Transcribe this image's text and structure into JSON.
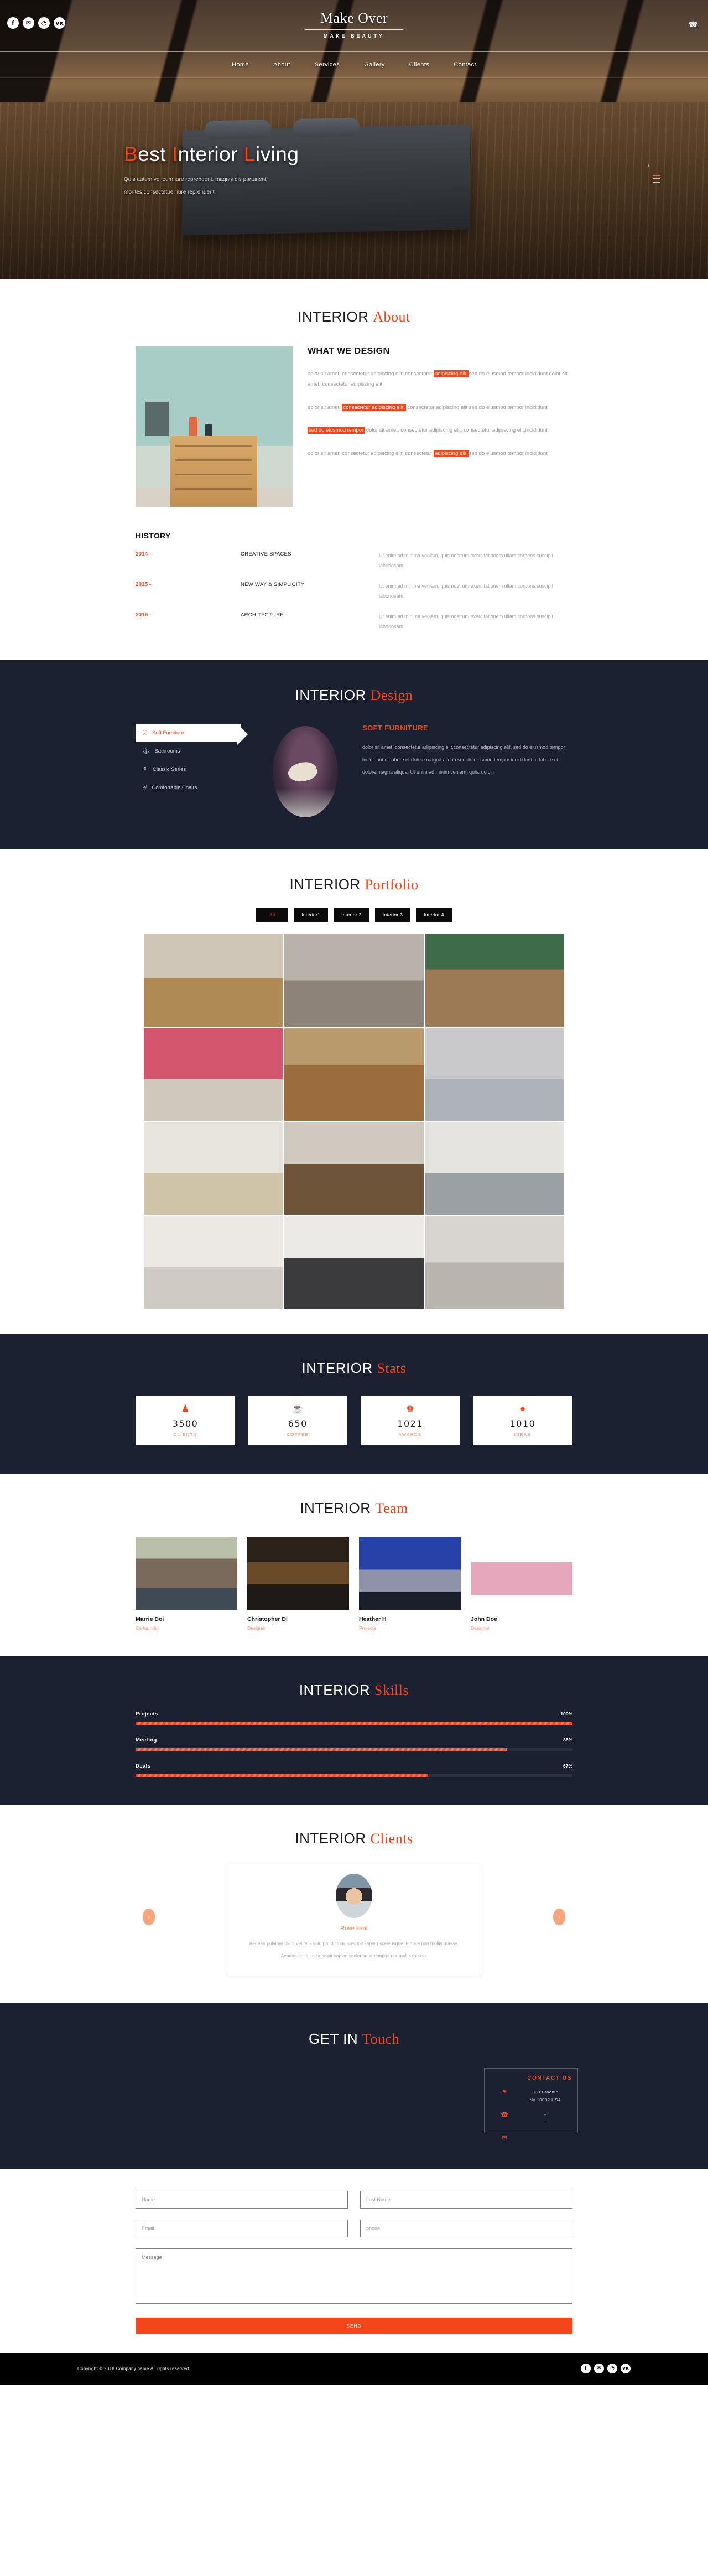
{
  "colors": {
    "accent": "#f4461a",
    "dark": "#1b2130",
    "black": "#000000",
    "muted": "#9a9a9a"
  },
  "header": {
    "brand_name": "Make Over",
    "brand_sub": "MAKE BEAUTY",
    "social": [
      {
        "name": "facebook-icon",
        "glyph": "f"
      },
      {
        "name": "twitter-icon",
        "glyph": "✉"
      },
      {
        "name": "rss-icon",
        "glyph": "◔"
      },
      {
        "name": "vk-icon",
        "glyph": "ᴠᴋ"
      }
    ],
    "phone_icon": "☎",
    "nav": [
      {
        "label": "Home"
      },
      {
        "label": "About"
      },
      {
        "label": "Services"
      },
      {
        "label": "Gallery"
      },
      {
        "label": "Clients"
      },
      {
        "label": "Contact"
      }
    ]
  },
  "hero": {
    "title_parts": [
      {
        "text": "B",
        "hl": true
      },
      {
        "text": "est ",
        "hl": false
      },
      {
        "text": "I",
        "hl": true
      },
      {
        "text": "nterior ",
        "hl": false
      },
      {
        "text": "L",
        "hl": true
      },
      {
        "text": "iving",
        "hl": false
      }
    ],
    "subtitle": "Quis autem vel eum iure reprehderit. magnis dis parturient montes,consectetuer iure reprehderit."
  },
  "about": {
    "title_main": "INTERIOR",
    "title_accent": "About",
    "heading": "WHAT WE DESIGN",
    "paragraphs": [
      [
        {
          "t": "dolor sit amet, consectetur adipiscing elit, consectetur ",
          "m": false
        },
        {
          "t": "adipiscing elit,",
          "m": true
        },
        {
          "t": "sed do eiusmod tempor incididunt dolor sit amet, consectetur adipiscing elit,",
          "m": false
        }
      ],
      [
        {
          "t": "dolor sit amet, ",
          "m": false
        },
        {
          "t": "consectetur adipiscing elit,",
          "m": true
        },
        {
          "t": " consectetur adipiscing elit,sed do eiusmod tempor incididunt",
          "m": false
        }
      ],
      [
        {
          "t": "sed do eiusmod tempor",
          "m": true
        },
        {
          "t": " dolor sit amet, consectetur adipiscing elit, consectetur adipiscing elit,incididunt",
          "m": false
        }
      ],
      [
        {
          "t": "dolor sit amet, consectetur adipiscing elit, consectetur ",
          "m": false
        },
        {
          "t": "adipiscing elit,",
          "m": true
        },
        {
          "t": "sed do eiusmod tempor incididunt",
          "m": false
        }
      ]
    ]
  },
  "history": {
    "heading": "HISTORY",
    "rows": [
      {
        "year": "2014 -",
        "title": "CREATIVE SPACES",
        "desc": "Ut enim ad minima veniam, quis nostrum exercitationem ullam corporis suscipit laboriosam."
      },
      {
        "year": "2015 -",
        "title": "NEW WAY & SIMPLICITY",
        "desc": "Ut enim ad minima veniam, quis nostrum exercitationem ullam corporis suscipit laboriosam."
      },
      {
        "year": "2016 -",
        "title": "ARCHITECTURE",
        "desc": "Ut enim ad minima veniam, quis nostrum exercitationem ullam corporis suscipit laboriosam."
      }
    ]
  },
  "design": {
    "title_main": "INTERIOR",
    "title_accent": "Design",
    "menu": [
      {
        "label": "Soft Furniture",
        "icon": "shuffle-icon",
        "glyph": "⤨",
        "active": true
      },
      {
        "label": "Bathrooms",
        "icon": "anchor-icon",
        "glyph": "⚓",
        "active": false
      },
      {
        "label": "Classic Series",
        "icon": "lamp-icon",
        "glyph": "⚘",
        "active": false
      },
      {
        "label": "Comfortable Chairs",
        "icon": "shield-icon",
        "glyph": "⛨",
        "active": false
      }
    ],
    "panel_heading": "SOFT FURNITURE",
    "panel_text": "dolor sit amet, consectetur adipiscing elit,consectetur adipiscing elit, sed do eiusmod tempor incididunt ut labore et dolore magna aliqua sed do eiusmod tempor incididunt ut labore et dolore magna aliqua. Ut enim ad minim veniam, quis. dolor ."
  },
  "portfolio": {
    "title_main": "INTERIOR",
    "title_accent": "Portfolio",
    "filters": [
      {
        "label": "All",
        "active": true
      },
      {
        "label": "Interior1",
        "active": false
      },
      {
        "label": "Interior 2",
        "active": false
      },
      {
        "label": "Interior 3",
        "active": false
      },
      {
        "label": "Interior 4",
        "active": false
      }
    ],
    "items": [
      {
        "name": "yellow-chairs-window"
      },
      {
        "name": "white-sofa-living"
      },
      {
        "name": "tropical-wall-lounge"
      },
      {
        "name": "pink-banquette-dining"
      },
      {
        "name": "twin-beds-bedroom"
      },
      {
        "name": "grey-attic-bedroom"
      },
      {
        "name": "olive-curtain-dining"
      },
      {
        "name": "chandelier-master-bedroom"
      },
      {
        "name": "open-plan-kitchen"
      },
      {
        "name": "white-pendant-kitchen"
      },
      {
        "name": "black-pendant-kitchen"
      },
      {
        "name": "modern-grey-kitchen"
      }
    ]
  },
  "stats": {
    "title_main": "INTERIOR",
    "title_accent": "Stats",
    "cards": [
      {
        "icon": "users-icon",
        "glyph": "♟",
        "value": "3500",
        "label": "CLIENTS"
      },
      {
        "icon": "coffee-icon",
        "glyph": "☕",
        "value": "650",
        "label": "COFFEE"
      },
      {
        "icon": "trophy-icon",
        "glyph": "♚",
        "value": "1021",
        "label": "AWARDS"
      },
      {
        "icon": "lightbulb-icon",
        "glyph": "●",
        "value": "1010",
        "label": "IDEAS"
      }
    ]
  },
  "team": {
    "title_main": "INTERIOR",
    "title_accent": "Team",
    "members": [
      {
        "name": "Marrie Doi",
        "role": "Co-founder"
      },
      {
        "name": "Christopher Di",
        "role": "Designer"
      },
      {
        "name": "Heather H",
        "role": "Projects"
      },
      {
        "name": "John Doe",
        "role": "Designer"
      }
    ]
  },
  "skills": {
    "title_main": "INTERIOR",
    "title_accent": "Skills",
    "items": [
      {
        "name": "Projects",
        "pct": "100%",
        "value": 100
      },
      {
        "name": "Meeting",
        "pct": "85%",
        "value": 85
      },
      {
        "name": "Deals",
        "pct": "67%",
        "value": 67
      }
    ]
  },
  "clients": {
    "title_main": "INTERIOR",
    "title_accent": "Clients",
    "prev_glyph": "‹",
    "next_glyph": "›",
    "testimonial": {
      "name": "Rose kent",
      "quote": "Aenean pulvinar diam vel felis volutpat dictum, suscipit sapien scelerisque tempus non mollis massa. Aenean ac tellus suscipit sapien scelerisque tempus nor mollis massa."
    }
  },
  "contact": {
    "title_main": "GET IN",
    "title_accent": "Touch",
    "card_title": "CONTACT US",
    "rows": [
      {
        "icon": "location-pin-icon",
        "glyph": "⚑",
        "value": "333 Broome\nNy 10002 USA"
      },
      {
        "icon": "phone-icon",
        "glyph": "☎",
        "value": "+\n+"
      },
      {
        "icon": "mail-icon",
        "glyph": "✉",
        "value": ""
      }
    ]
  },
  "form": {
    "first_name_placeholder": "Name",
    "last_name_placeholder": "Last Name",
    "email_placeholder": "Email",
    "phone_placeholder": "phone",
    "message_placeholder": "Message",
    "send_label": "SEND"
  },
  "footer": {
    "copyright": "Copyright © 2018.Company name All rights reserved.",
    "social": [
      {
        "name": "facebook-icon",
        "glyph": "f"
      },
      {
        "name": "twitter-icon",
        "glyph": "✉"
      },
      {
        "name": "rss-icon",
        "glyph": "◔"
      },
      {
        "name": "vk-icon",
        "glyph": "ᴠᴋ"
      }
    ]
  }
}
